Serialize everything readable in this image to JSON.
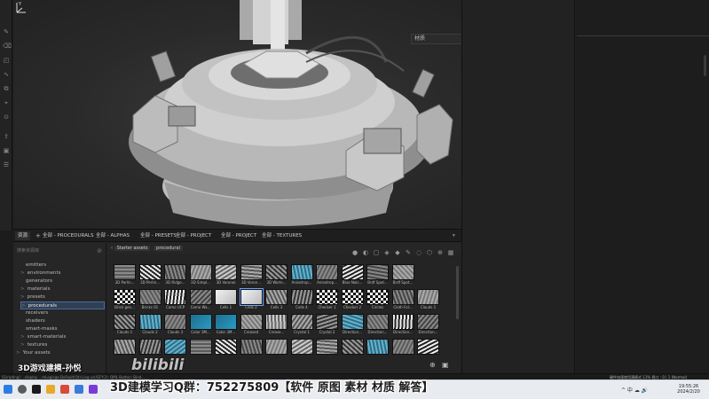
{
  "viewport": {
    "material_select": "材质",
    "axis_label": "Y"
  },
  "browser": {
    "tabs": [
      {
        "label": "资源"
      },
      {
        "label": "全部 - PROCEDURALS"
      },
      {
        "label": "全部 - ALPHAS"
      },
      {
        "label": "全部 - PRESETS"
      },
      {
        "label": "全部 - PROJECT"
      },
      {
        "label": "全部 - PROJECT"
      },
      {
        "label": "全部 - TEXTURES"
      }
    ],
    "search_placeholder": "搜索资源库",
    "tree": [
      {
        "label": "emitters",
        "arrow": ""
      },
      {
        "label": "environments",
        "arrow": ">"
      },
      {
        "label": "generators",
        "arrow": ""
      },
      {
        "label": "materials",
        "arrow": ">"
      },
      {
        "label": "presets",
        "arrow": ">"
      },
      {
        "label": "procedurals",
        "arrow": ">",
        "selected": true
      },
      {
        "label": "receivers",
        "arrow": ""
      },
      {
        "label": "shaders",
        "arrow": ""
      },
      {
        "label": "smart-masks",
        "arrow": ""
      },
      {
        "label": "smart-materials",
        "arrow": ">"
      },
      {
        "label": "textures",
        "arrow": ">"
      }
    ],
    "tree_root2": "Your assets",
    "breadcrumb": [
      "Starter assets",
      "procedural"
    ],
    "assets_row1": [
      "3D Perlin...",
      "3D Perlin...",
      "3D Ridge...",
      "3D Simpl...",
      "3D Voronoi",
      "3D Voron...",
      "3D Worle...",
      "Anisotrop...",
      "Anisotrop...",
      "Blue Nois...",
      "Brdf Spot...",
      "Brdf Spot..."
    ],
    "assets_row2": [
      "Brick gen...",
      "Bricks 01",
      "Camo UCP",
      "Camo Wa...",
      "Cells 1",
      "Cells 2",
      "Cells 3",
      "Cells 4",
      "Checker 1",
      "Checker 2",
      "Circles",
      "Cloth Fol...",
      "Clouds 1"
    ],
    "assets_row3": [
      "Clouds 1",
      "Clouds 2",
      "Clouds 3",
      "Color 3M...",
      "Color 3M...",
      "Creased",
      "Crease...",
      "Crystal 1",
      "Crystal 2",
      "Direction...",
      "Direction...",
      "Direction...",
      "Direction..."
    ],
    "assets_row4": [
      "",
      "",
      "",
      "",
      "",
      "",
      "",
      "",
      "",
      "",
      "",
      "",
      ""
    ]
  },
  "overlay": {
    "banner": "3D游戏建模-孙悦",
    "bili": "bilibili",
    "promo": "3D建模学习Q群：752275809【软件 原图 素材 材质 解答】"
  },
  "status": {
    "message": "[Scripting] ...display ...mLogicge.DeFault(Qt) Ling ud.lSFY:2): QML Button: Bind...",
    "right": "硬件加速使用满模式     11%   视口 : 0 | 1 (Normal)"
  },
  "taskbar": {
    "time": "19:55:26",
    "date": "2024/2/20",
    "tray": "^ 中 ☁ 🔊"
  },
  "colors": {
    "selection": "#6aa0ff",
    "tree_selected_bg": "#2f3f55",
    "taskbar": "#e8ebf0"
  }
}
